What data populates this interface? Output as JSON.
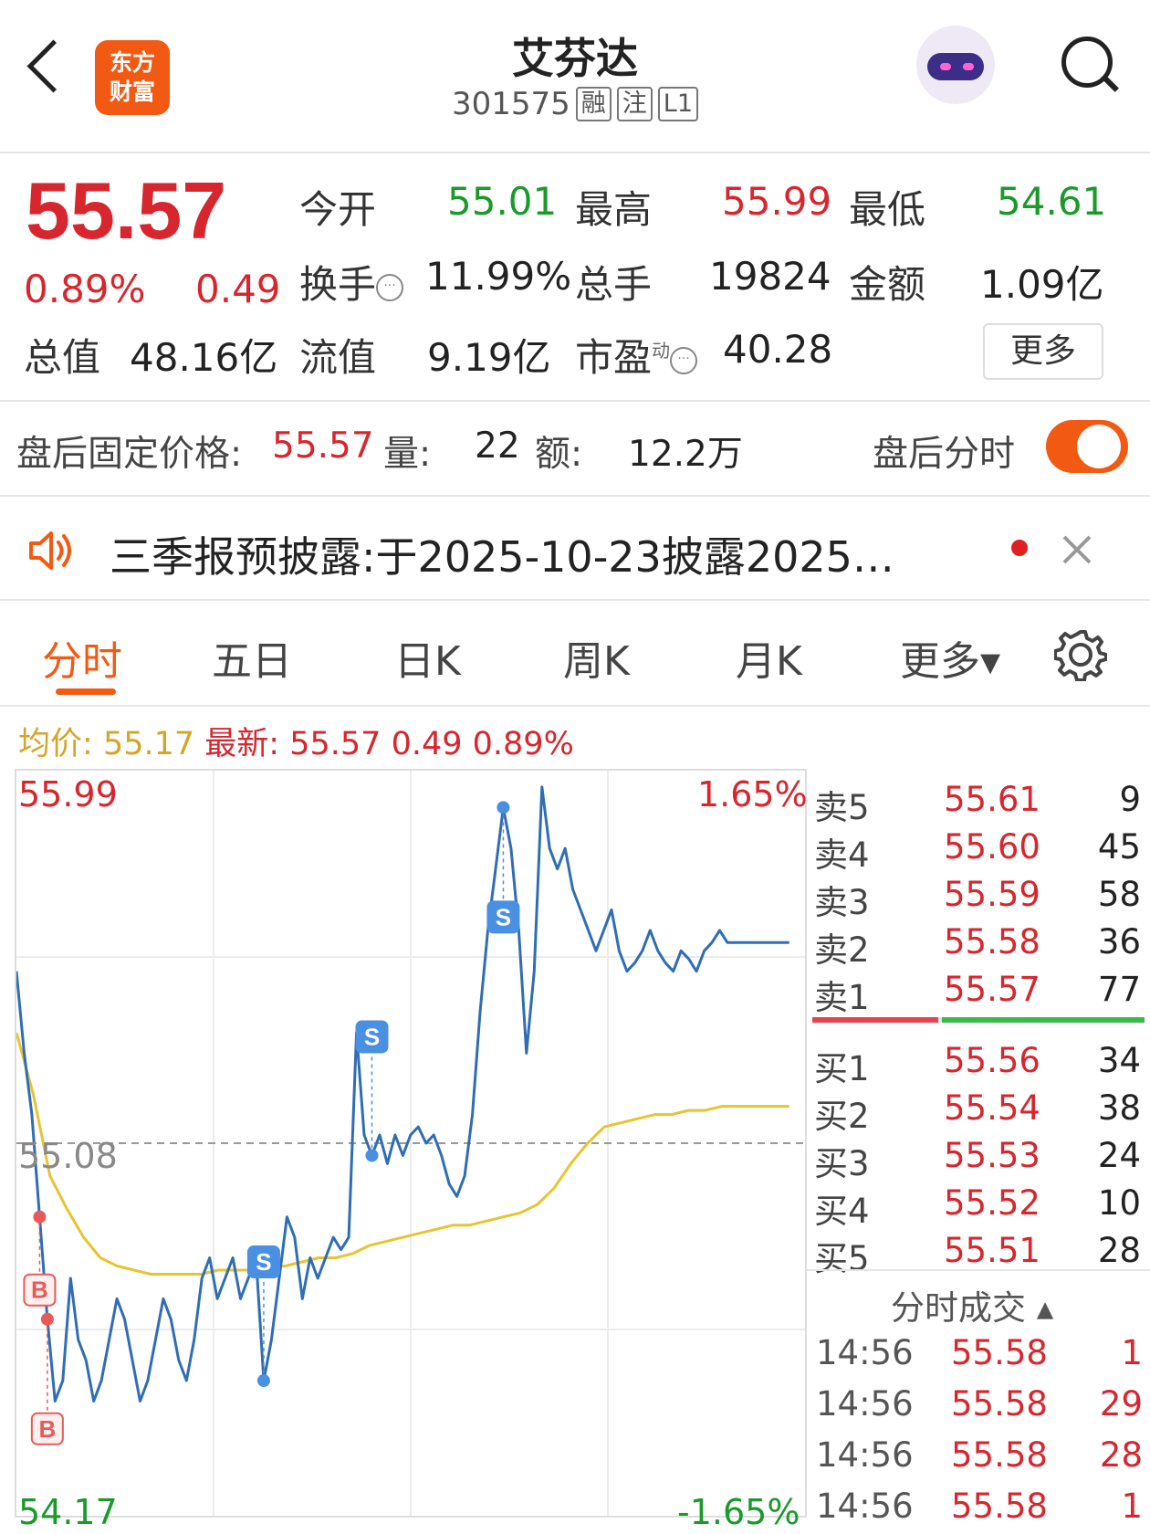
{
  "header": {
    "logo_line1": "东方",
    "logo_line2": "财富",
    "title": "艾芬达",
    "code": "301575",
    "tags": [
      "融",
      "注",
      "L1"
    ]
  },
  "quote": {
    "price": "55.57",
    "pct": "0.89%",
    "change": "0.49",
    "open_label": "今开",
    "open": "55.01",
    "high_label": "最高",
    "high": "55.99",
    "low_label": "最低",
    "low": "54.61",
    "turnover_label": "换手",
    "turnover": "11.99%",
    "volume_label": "总手",
    "volume": "19824",
    "amount_label": "金额",
    "amount": "1.09亿",
    "mktcap_label": "总值",
    "mktcap": "48.16亿",
    "float_label": "流值",
    "float": "9.19亿",
    "pe_label": "市盈",
    "pe_sup": "动",
    "pe": "40.28",
    "more": "更多"
  },
  "after_hours": {
    "label": "盘后固定价格:",
    "price": "55.57",
    "vol_label": "量:",
    "vol": "22",
    "amt_label": "额:",
    "amt": "12.2万",
    "toggle_label": "盘后分时",
    "toggle_on": true
  },
  "notice": {
    "text": "三季报预披露:于2025-10-23披露2025…"
  },
  "tabs": [
    "分时",
    "五日",
    "日K",
    "周K",
    "月K",
    "更多▾"
  ],
  "active_tab": 0,
  "chart_header": {
    "avg_label": "均价:",
    "avg": "55.17",
    "latest_label": "最新:",
    "latest": "55.57",
    "latest_change": "0.49",
    "latest_pct": "0.89%"
  },
  "chart_data": {
    "type": "line",
    "y_max_label": "55.99",
    "y_min_label": "54.17",
    "y_mid_label": "55.08",
    "pct_max_label": "1.65%",
    "pct_min_label": "-1.65%",
    "ylim": [
      54.17,
      55.99
    ],
    "prev_close": 55.08,
    "series": [
      {
        "values": [
          55.5,
          55.3,
          55.15,
          54.9,
          54.65,
          54.45,
          54.5,
          54.75,
          54.6,
          54.55,
          54.45,
          54.5,
          54.6,
          54.7,
          54.65,
          54.55,
          54.45,
          54.5,
          54.6,
          54.7,
          54.65,
          54.55,
          54.5,
          54.6,
          54.75,
          54.8,
          54.7,
          54.75,
          54.8,
          54.7,
          54.75,
          54.8,
          54.5,
          54.6,
          54.75,
          54.9,
          54.85,
          54.7,
          54.8,
          54.75,
          54.8,
          54.85,
          54.82,
          54.85,
          55.35,
          55.1,
          55.05,
          55.1,
          55.03,
          55.1,
          55.05,
          55.1,
          55.12,
          55.08,
          55.1,
          55.05,
          54.98,
          54.95,
          55.0,
          55.15,
          55.4,
          55.6,
          55.75,
          55.9,
          55.8,
          55.6,
          55.3,
          55.5,
          55.95,
          55.8,
          55.75,
          55.8,
          55.7,
          55.65,
          55.6,
          55.55,
          55.6,
          55.65,
          55.55,
          55.5,
          55.52,
          55.55,
          55.6,
          55.55,
          55.52,
          55.5,
          55.55,
          55.53,
          55.5,
          55.55,
          55.57,
          55.6,
          55.57,
          55.57,
          55.57,
          55.57,
          55.57,
          55.57,
          55.57,
          55.57,
          55.57
        ]
      },
      {
        "values": [
          55.35,
          55.2,
          55.0,
          54.92,
          54.85,
          54.8,
          54.78,
          54.77,
          54.76,
          54.76,
          54.76,
          54.76,
          54.77,
          54.77,
          54.77,
          54.78,
          54.78,
          54.79,
          54.8,
          54.8,
          54.81,
          54.83,
          54.84,
          54.85,
          54.86,
          54.87,
          54.88,
          54.88,
          54.89,
          54.9,
          54.91,
          54.93,
          54.97,
          55.03,
          55.08,
          55.12,
          55.13,
          55.14,
          55.15,
          55.15,
          55.16,
          55.16,
          55.17,
          55.17,
          55.17,
          55.17,
          55.17
        ]
      }
    ],
    "markers": [
      "B",
      "B",
      "S",
      "S",
      "S"
    ]
  },
  "order_book": {
    "asks": [
      {
        "label": "卖5",
        "price": "55.61",
        "vol": "9"
      },
      {
        "label": "卖4",
        "price": "55.60",
        "vol": "45"
      },
      {
        "label": "卖3",
        "price": "55.59",
        "vol": "58"
      },
      {
        "label": "卖2",
        "price": "55.58",
        "vol": "36"
      },
      {
        "label": "卖1",
        "price": "55.57",
        "vol": "77"
      }
    ],
    "bids": [
      {
        "label": "买1",
        "price": "55.56",
        "vol": "34"
      },
      {
        "label": "买2",
        "price": "55.54",
        "vol": "38"
      },
      {
        "label": "买3",
        "price": "55.53",
        "vol": "24"
      },
      {
        "label": "买4",
        "price": "55.52",
        "vol": "10"
      },
      {
        "label": "买5",
        "price": "55.51",
        "vol": "28"
      }
    ],
    "ratio": 0.38,
    "trades_title": "分时成交 ▴",
    "trades": [
      {
        "time": "14:56",
        "price": "55.58",
        "vol": "1"
      },
      {
        "time": "14:56",
        "price": "55.58",
        "vol": "29"
      },
      {
        "time": "14:56",
        "price": "55.58",
        "vol": "28"
      },
      {
        "time": "14:56",
        "price": "55.58",
        "vol": "1"
      }
    ]
  },
  "colors": {
    "accent": "#f25a13",
    "up": "#d7262e",
    "down": "#1a9a2b",
    "price_line": "#2f6db5",
    "avg_line": "#e8c431"
  }
}
